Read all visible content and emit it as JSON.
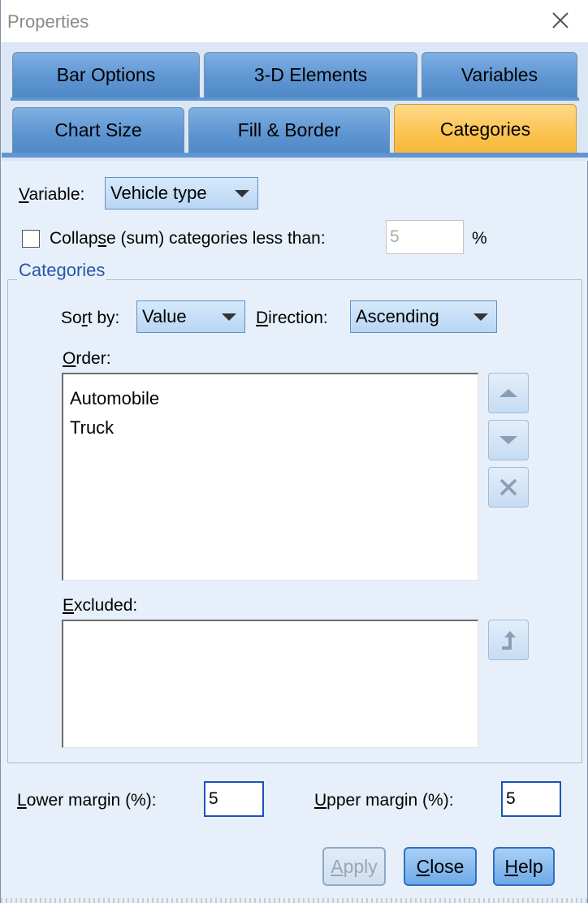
{
  "window": {
    "title": "Properties"
  },
  "tabs": {
    "row1": [
      {
        "label": "Bar Options"
      },
      {
        "label": "3-D Elements"
      },
      {
        "label": "Variables"
      }
    ],
    "row2": [
      {
        "label": "Chart Size"
      },
      {
        "label": "Fill & Border"
      },
      {
        "label": "Categories",
        "active": true
      }
    ]
  },
  "variable": {
    "label_pre": "",
    "label_u": "V",
    "label_post": "ariable:",
    "value": "Vehicle type"
  },
  "collapse": {
    "label_pre": "Collap",
    "label_u": "s",
    "label_post": "e (sum) categories less than:",
    "checked": false,
    "value": "5",
    "unit": "%"
  },
  "categories_group": {
    "title": "Categories",
    "sort_by": {
      "label_pre": "So",
      "label_u": "r",
      "label_post": "t by:",
      "value": "Value"
    },
    "direction": {
      "label_pre": "",
      "label_u": "D",
      "label_post": "irection:",
      "value": "Ascending"
    },
    "order": {
      "label_pre": "",
      "label_u": "O",
      "label_post": "rder:",
      "items": [
        "Automobile",
        "Truck"
      ]
    },
    "excluded": {
      "label_pre": "",
      "label_u": "E",
      "label_post": "xcluded:",
      "items": []
    }
  },
  "margins": {
    "lower": {
      "label_u": "L",
      "label_post": "ower margin (%):",
      "value": "5"
    },
    "upper": {
      "label_u": "U",
      "label_post": "pper margin (%):",
      "value": "5"
    }
  },
  "buttons": {
    "apply": {
      "u": "A",
      "rest": "pply"
    },
    "close": {
      "u": "C",
      "rest": "lose"
    },
    "help": {
      "u": "H",
      "rest": "elp"
    }
  },
  "colors": {
    "tab_blue": "#5f96d2",
    "tab_active": "#fbc24e",
    "panel": "#e7f0fa",
    "group_title": "#2a55a5"
  }
}
